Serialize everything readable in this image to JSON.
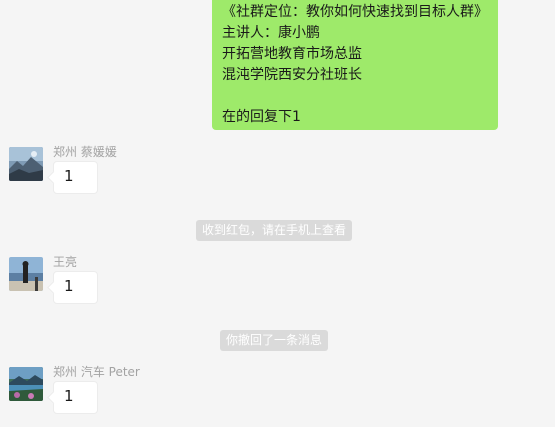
{
  "outgoing": {
    "lines": [
      "《社群定位：教你如何快速找到目标人群》",
      "主讲人：康小鹏",
      "开拓营地教育市场总监",
      "混沌学院西安分社班长",
      "",
      "在的回复下1"
    ]
  },
  "messages": [
    {
      "sender": "郑州 蔡媛媛",
      "text": "1",
      "avatar": "avatar-mountain"
    },
    {
      "sender": "王亮",
      "text": "1",
      "avatar": "avatar-person-beach"
    },
    {
      "sender": "郑州 汽车 Peter",
      "text": "1",
      "avatar": "avatar-landscape"
    }
  ],
  "notices": {
    "red_packet": "收到红包，请在手机上查看",
    "recalled": "你撤回了一条消息"
  },
  "colors": {
    "background": "#f5f5f5",
    "outgoing_bubble": "#9eea6a",
    "notice_bg": "#dadada",
    "sender_text": "#a3a3a3"
  }
}
